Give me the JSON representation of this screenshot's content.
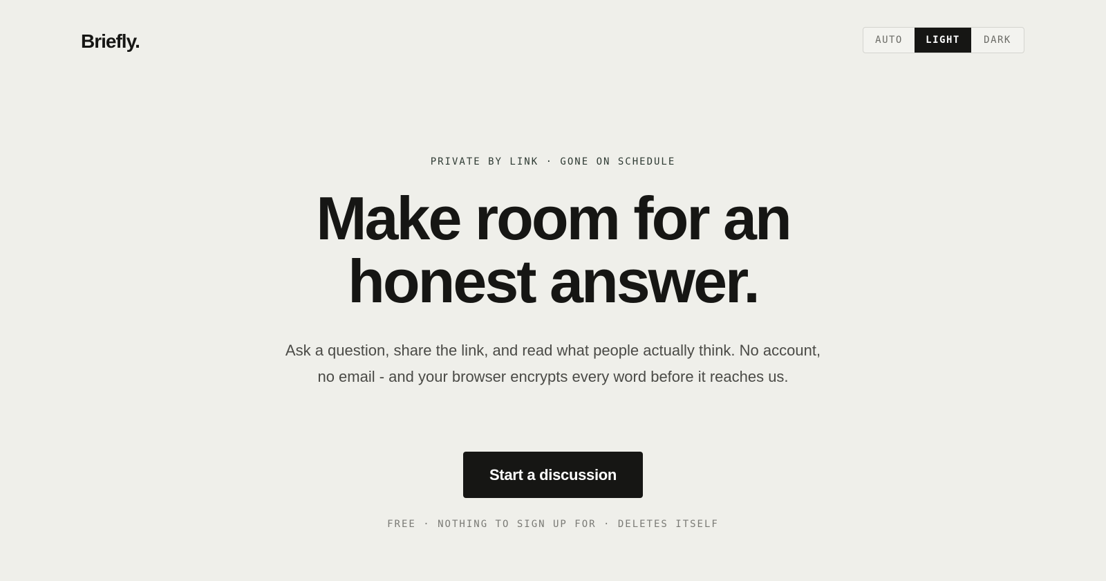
{
  "brand": {
    "logo_text": "Briefly."
  },
  "theme_toggle": {
    "options": [
      "AUTO",
      "LIGHT",
      "DARK"
    ],
    "selected": "LIGHT"
  },
  "hero": {
    "eyebrow": "PRIVATE BY LINK · GONE ON SCHEDULE",
    "headline_line1": "Make room for an",
    "headline_line2": "honest answer.",
    "subcopy": "Ask a question, share the link, and read what people actually think. No account, no email - and your browser encrypts every word before it reaches us.",
    "cta_label": "Start a discussion",
    "footnote": "FREE · NOTHING TO SIGN UP FOR · DELETES ITSELF"
  },
  "colors": {
    "background": "#efefea",
    "text": "#161614",
    "accent_dark": "#161614",
    "muted_text": "#4a4a46"
  }
}
